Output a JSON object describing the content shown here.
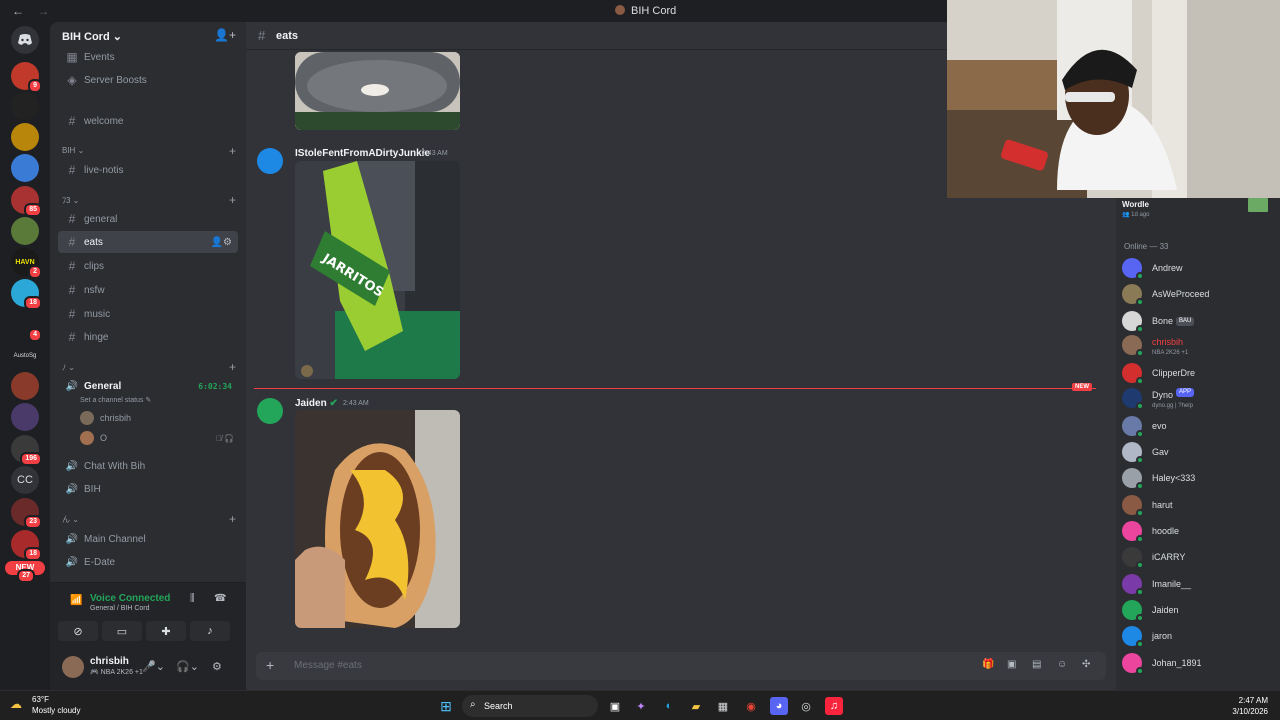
{
  "window": {
    "title": "BIH Cord",
    "back": "←",
    "forward": "→"
  },
  "server_rail": {
    "badges": [
      "9",
      "85",
      "2",
      "18",
      "4",
      "196",
      "23",
      "18",
      "27"
    ],
    "text_server": "CC",
    "new_label": "NEW",
    "small_label": "AustoSg"
  },
  "sidebar": {
    "guild_name": "BIH Cord",
    "top_items": [
      "Events",
      "Server Boosts"
    ],
    "welcome": "welcome",
    "categories": [
      "BIH",
      "ﾌ3",
      "ﾉ",
      "ん"
    ],
    "channels": {
      "bih": [
        "live-notis"
      ],
      "main": [
        "general",
        "eats",
        "clips",
        "nsfw",
        "music",
        "hinge"
      ]
    },
    "voice": {
      "general": "General",
      "timer": "6:02:34",
      "status_prompt": "Set a channel status",
      "users": [
        "chrisbih",
        "O"
      ],
      "others": [
        "Chat With Bih",
        "BIH"
      ],
      "last_category": [
        "Main Channel",
        "E-Date"
      ]
    }
  },
  "voice_panel": {
    "title": "Voice Connected",
    "subtitle": "General / BIH Cord"
  },
  "user_panel": {
    "name": "chrisbih",
    "status": "NBA 2K26 +1"
  },
  "chat": {
    "channel": "eats",
    "messages": [
      {
        "author": "IStoleFentFromADirtyJunkie",
        "time": "2:43 AM"
      },
      {
        "author": "Jaiden",
        "time": "2:43 AM"
      }
    ],
    "new_tag": "NEW",
    "composer_placeholder": "Message #eats",
    "bottle_text": "JARRITOS"
  },
  "members": {
    "activity": {
      "name": "Wordle",
      "time": "1d ago"
    },
    "online_header": "Online — 33",
    "list": [
      {
        "name": "Andrew",
        "color": "#5865f2"
      },
      {
        "name": "AsWeProceed",
        "color": "#8a7a55"
      },
      {
        "name": "Bone",
        "color": "#d7d7d7",
        "badge": "BAU"
      },
      {
        "name": "chrisbih",
        "color": "#8a6a55",
        "sub": "NBA 2K26 +1",
        "name_color": "#f23f43"
      },
      {
        "name": "ClipperDre",
        "color": "#d32f2f"
      },
      {
        "name": "Dyno",
        "color": "#1f3a6e",
        "badge": "APP",
        "sub": "dyno.gg | ?help"
      },
      {
        "name": "evo",
        "color": "#6a7aa8"
      },
      {
        "name": "Gav",
        "color": "#b0b8c8"
      },
      {
        "name": "Haley<333",
        "color": "#9aa0a8"
      },
      {
        "name": "harut",
        "color": "#8a5a44"
      },
      {
        "name": "hoodle",
        "color": "#eb459e"
      },
      {
        "name": "iCARRY",
        "color": "#3a3a3a"
      },
      {
        "name": "Imanile__",
        "color": "#7a3aa8"
      },
      {
        "name": "Jaiden",
        "color": "#23a55a"
      },
      {
        "name": "jaron",
        "color": "#1e88e5"
      },
      {
        "name": "Johan_1891",
        "color": "#eb459e"
      }
    ]
  },
  "taskbar": {
    "weather_temp": "63°F",
    "weather_cond": "Mostly cloudy",
    "search": "Search",
    "time": "2:47 AM",
    "date": "3/10/2026"
  }
}
